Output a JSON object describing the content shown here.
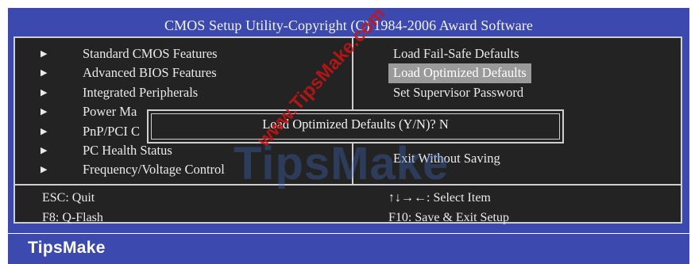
{
  "window": {
    "title": "CMOS Setup Utility-Copyright (C) 1984-2006 Award Software"
  },
  "left_menu": [
    {
      "label": "Standard CMOS Features"
    },
    {
      "label": "Advanced BIOS Features"
    },
    {
      "label": "Integrated Peripherals"
    },
    {
      "label": "Power Ma"
    },
    {
      "label": "PnP/PCI C"
    },
    {
      "label": "PC Health Status"
    },
    {
      "label": "Frequency/Voltage Control"
    }
  ],
  "right_menu": [
    {
      "label": "Load Fail-Safe Defaults"
    },
    {
      "label": "Load Optimized Defaults",
      "selected": true
    },
    {
      "label": "Set Supervisor Password"
    },
    {
      "label": ""
    },
    {
      "label": ""
    },
    {
      "label": "Exit Without Saving"
    }
  ],
  "dialog": {
    "prompt": "Load Optimized Defaults (Y/N)? N"
  },
  "footer": {
    "left": [
      "ESC: Quit",
      "F8: Q-Flash"
    ],
    "right": [
      "↑↓→←: Select Item",
      "F10: Save & Exit Setup"
    ]
  },
  "brand": {
    "name": "TipsMake"
  },
  "watermark": {
    "logo": "TipsMake",
    "url": "www.TipsMake.com"
  },
  "colors": {
    "bios_blue": "#3c49ae",
    "panel_bg": "#232323",
    "highlight": "#9a9a9a"
  }
}
